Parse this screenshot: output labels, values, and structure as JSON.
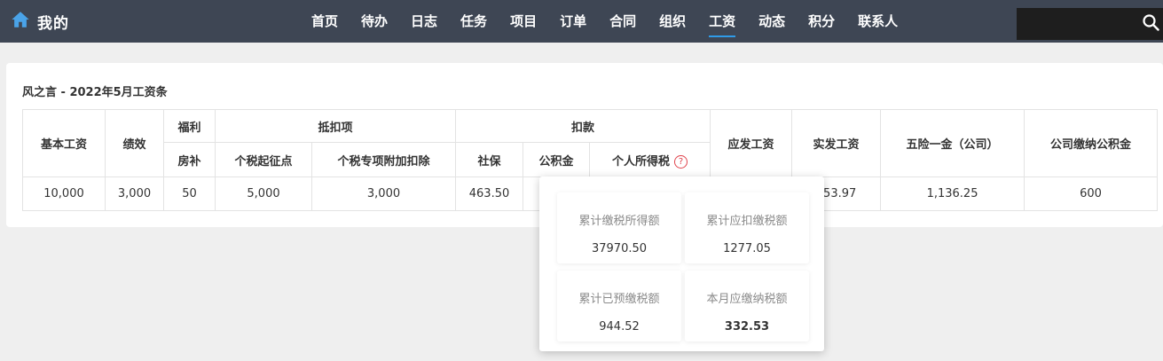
{
  "brand": {
    "title": "我的",
    "icon": "home-icon",
    "accent": "#4aa3e8"
  },
  "nav": {
    "items": [
      {
        "label": "首页"
      },
      {
        "label": "待办"
      },
      {
        "label": "日志"
      },
      {
        "label": "任务"
      },
      {
        "label": "项目"
      },
      {
        "label": "订单"
      },
      {
        "label": "合同"
      },
      {
        "label": "组织"
      },
      {
        "label": "工资",
        "active": true
      },
      {
        "label": "动态"
      },
      {
        "label": "积分"
      },
      {
        "label": "联系人"
      }
    ],
    "search": {
      "value": "",
      "icon": "search-icon"
    }
  },
  "payslip": {
    "title": "风之言 - 2022年5月工资条",
    "headers": {
      "base_salary": "基本工资",
      "performance": "绩效",
      "welfare": "福利",
      "deductibles": "抵扣项",
      "deductions": "扣款",
      "gross_pay": "应发工资",
      "net_pay": "实发工资",
      "insurance_company": "五险一金（公司）",
      "housing_fund_company": "公司缴纳公积金",
      "housing_allowance": "房补",
      "tax_threshold": "个税起征点",
      "special_deduction": "个税专项附加扣除",
      "social_security": "社保",
      "housing_fund": "公积金",
      "income_tax": "个人所得税",
      "help_glyph": "?"
    },
    "row": {
      "base_salary": "10,000",
      "performance": "3,000",
      "housing_allowance": "50",
      "tax_threshold": "5,000",
      "special_deduction": "3,000",
      "social_security": "463.50",
      "housing_fund": "",
      "income_tax": "",
      "gross_pay": "",
      "net_pay": "153.97",
      "insurance_company": "1,136.25",
      "housing_fund_company": "600"
    }
  },
  "tax_popover": {
    "tiles": [
      {
        "label": "累计缴税所得额",
        "value": "37970.50"
      },
      {
        "label": "累计应扣缴税额",
        "value": "1277.05"
      },
      {
        "label": "累计已预缴税额",
        "value": "944.52"
      },
      {
        "label": "本月应缴纳税额",
        "value": "332.53",
        "bold": true
      }
    ]
  },
  "colors": {
    "topbar": "#3e4654",
    "nav_active_underline": "#2f9be8",
    "help_icon": "#e0434c"
  }
}
